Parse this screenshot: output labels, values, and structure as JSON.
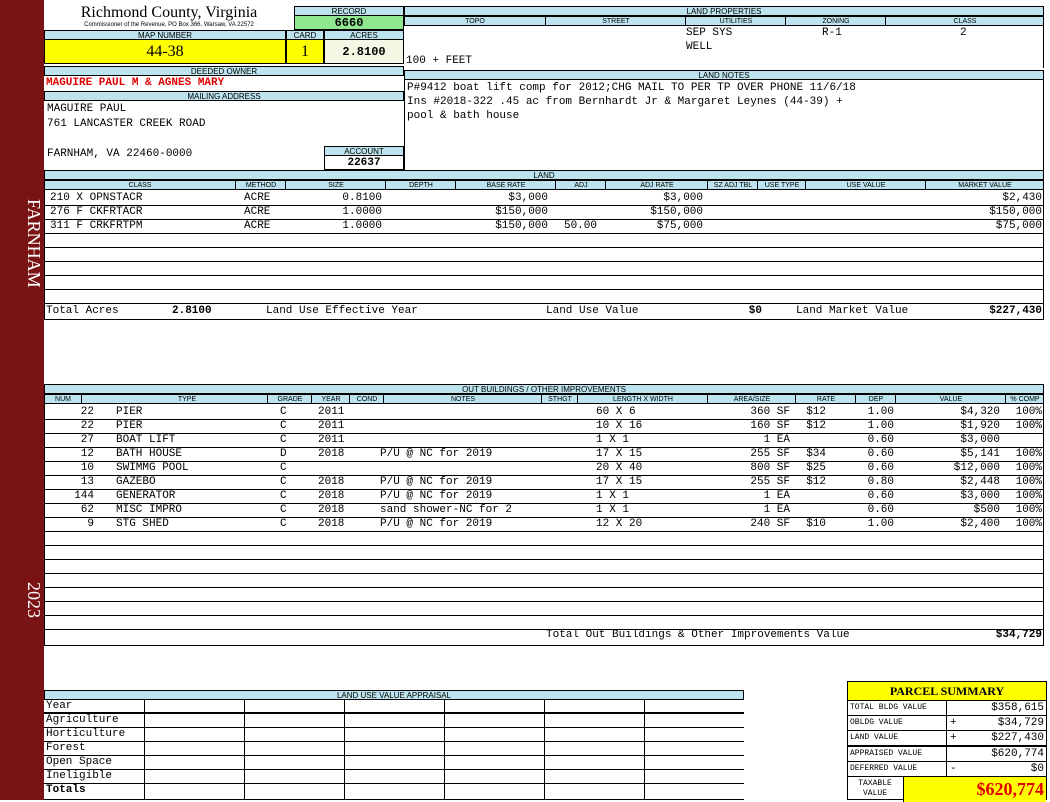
{
  "sidebar": {
    "area_name": "FARNHAM",
    "year": "2023"
  },
  "county": {
    "name": "Richmond County, Virginia",
    "address": "Commissioner of the Revenue, PO Box 366, Warsaw, VA 22572"
  },
  "record": {
    "label": "RECORD",
    "value": "6660"
  },
  "map_number": {
    "label": "MAP NUMBER",
    "value": "44-38"
  },
  "card": {
    "label": "CARD",
    "value": "1"
  },
  "acres": {
    "label": "ACRES",
    "value": "2.8100"
  },
  "deeded_owner": {
    "label": "DEEDED OWNER",
    "value": "MAGUIRE PAUL M & AGNES MARY"
  },
  "mailing": {
    "label": "MAILING ADDRESS",
    "line1": "MAGUIRE PAUL",
    "line2": "761 LANCASTER CREEK ROAD",
    "line3": "FARNHAM, VA 22460-0000"
  },
  "account": {
    "label": "ACCOUNT",
    "value": "22637"
  },
  "land_properties": {
    "label": "LAND PROPERTIES",
    "headers": {
      "topo": "TOPO",
      "street": "STREET",
      "utilities": "UTILITIES",
      "zoning": "ZONING",
      "class": "CLASS"
    },
    "utilities1": "SEP SYS",
    "utilities2": "WELL",
    "zoning": "R-1",
    "class": "2",
    "frontage": "100 + FEET"
  },
  "land_notes": {
    "label": "LAND NOTES",
    "line1": "P#9412 boat lift comp for 2012;CHG MAIL TO PER TP OVER PHONE 11/6/18",
    "line2": "Ins #2018-322 .45 ac from Bernhardt Jr & Margaret Leynes (44-39) +",
    "line3": "pool & bath house"
  },
  "land": {
    "label": "LAND",
    "headers": {
      "class": "CLASS",
      "method": "METHOD",
      "size": "SIZE",
      "depth": "DEPTH",
      "base_rate": "BASE RATE",
      "adj": "ADJ",
      "adj_rate": "ADJ RATE",
      "sz_adj_tbl": "SZ ADJ TBL",
      "use_type": "USE TYPE",
      "use_value": "USE VALUE",
      "market_value": "MARKET VALUE"
    },
    "rows": [
      {
        "class": "210 X OPNSTACR",
        "method": "ACRE",
        "size": "0.8100",
        "base_rate": "$3,000",
        "adj": "",
        "adj_rate": "$3,000",
        "market_value": "$2,430"
      },
      {
        "class": "276 F CKFRTACR",
        "method": "ACRE",
        "size": "1.0000",
        "base_rate": "$150,000",
        "adj": "",
        "adj_rate": "$150,000",
        "market_value": "$150,000"
      },
      {
        "class": "311 F CRKFRTPM",
        "method": "ACRE",
        "size": "1.0000",
        "base_rate": "$150,000",
        "adj": "50.00",
        "adj_rate": "$75,000",
        "market_value": "$75,000"
      }
    ],
    "totals": {
      "total_acres_label": "Total Acres",
      "total_acres": "2.8100",
      "effective_year_label": "Land Use Effective Year",
      "use_value_label": "Land Use Value",
      "use_value": "$0",
      "market_value_label": "Land Market Value",
      "market_value": "$227,430"
    }
  },
  "outbuildings": {
    "label": "OUT BUILDINGS / OTHER IMPROVEMENTS",
    "headers": {
      "num": "NUM",
      "type": "TYPE",
      "grade": "GRADE",
      "year": "YEAR",
      "cond": "COND",
      "notes": "NOTES",
      "sthgt": "STHGT",
      "length_width": "LENGTH X WIDTH",
      "area_size": "AREA/SIZE",
      "rate": "RATE",
      "dep": "DEP",
      "value": "VALUE",
      "pct_comp": "% COMP"
    },
    "rows": [
      {
        "num": "22",
        "type": "PIER",
        "grade": "C",
        "year": "2011",
        "notes": "",
        "lw": "60 X 6",
        "area": "360 SF",
        "rate": "$12",
        "dep": "1.00",
        "value": "$4,320",
        "comp": "100%"
      },
      {
        "num": "22",
        "type": "PIER",
        "grade": "C",
        "year": "2011",
        "notes": "",
        "lw": "10 X 16",
        "area": "160 SF",
        "rate": "$12",
        "dep": "1.00",
        "value": "$1,920",
        "comp": "100%"
      },
      {
        "num": "27",
        "type": "BOAT LIFT",
        "grade": "C",
        "year": "2011",
        "notes": "",
        "lw": "1 X 1",
        "area": "1 EA",
        "rate": "",
        "dep": "0.60",
        "value": "$3,000",
        "comp": ""
      },
      {
        "num": "12",
        "type": "BATH HOUSE",
        "grade": "D",
        "year": "2018",
        "notes": "P/U @ NC for 2019",
        "lw": "17 X 15",
        "area": "255 SF",
        "rate": "$34",
        "dep": "0.60",
        "value": "$5,141",
        "comp": "100%"
      },
      {
        "num": "10",
        "type": "SWIMMG POOL",
        "grade": "C",
        "year": "",
        "notes": "",
        "lw": "20 X 40",
        "area": "800 SF",
        "rate": "$25",
        "dep": "0.60",
        "value": "$12,000",
        "comp": "100%"
      },
      {
        "num": "13",
        "type": "GAZEBO",
        "grade": "C",
        "year": "2018",
        "notes": "P/U @ NC for 2019",
        "lw": "17 X 15",
        "area": "255 SF",
        "rate": "$12",
        "dep": "0.80",
        "value": "$2,448",
        "comp": "100%"
      },
      {
        "num": "144",
        "type": "GENERATOR",
        "grade": "C",
        "year": "2018",
        "notes": "P/U @ NC for 2019",
        "lw": "1 X 1",
        "area": "1 EA",
        "rate": "",
        "dep": "0.60",
        "value": "$3,000",
        "comp": "100%"
      },
      {
        "num": "62",
        "type": "MISC IMPRO",
        "grade": "C",
        "year": "2018",
        "notes": "sand shower-NC for 2",
        "lw": "1 X 1",
        "area": "1 EA",
        "rate": "",
        "dep": "0.60",
        "value": "$500",
        "comp": "100%"
      },
      {
        "num": "9",
        "type": "STG SHED",
        "grade": "C",
        "year": "2018",
        "notes": "P/U @ NC for 2019",
        "lw": "12 X 20",
        "area": "240 SF",
        "rate": "$10",
        "dep": "1.00",
        "value": "$2,400",
        "comp": "100%"
      }
    ],
    "total_label": "Total Out Buildings & Other Improvements Value",
    "total_value": "$34,729"
  },
  "land_use_appraisal": {
    "label": "LAND USE VALUE APPRAISAL",
    "rows": [
      "Year",
      "Agriculture",
      "Horticulture",
      "Forest",
      "Open Space",
      "Ineligible",
      "Totals"
    ]
  },
  "parcel_summary": {
    "label": "PARCEL SUMMARY",
    "total_bldg_label": "TOTAL BLDG VALUE",
    "total_bldg": "$358,615",
    "obldg_label": "OBLDG VALUE",
    "obldg_sign": "+",
    "obldg": "$34,729",
    "land_label": "LAND VALUE",
    "land_sign": "+",
    "land": "$227,430",
    "appraised_label": "APPRAISED VALUE",
    "appraised": "$620,774",
    "deferred_label": "DEFERRED VALUE",
    "deferred_sign": "-",
    "deferred": "$0",
    "taxable_label1": "TAXABLE",
    "taxable_label2": "VALUE",
    "taxable": "$620,774"
  },
  "colors": {
    "sidebar": "#7a1313",
    "header_blue": "#bde3ee",
    "highlight_yellow": "#ffff00",
    "record_green": "#8fe88f",
    "owner_red": "#e00000"
  }
}
